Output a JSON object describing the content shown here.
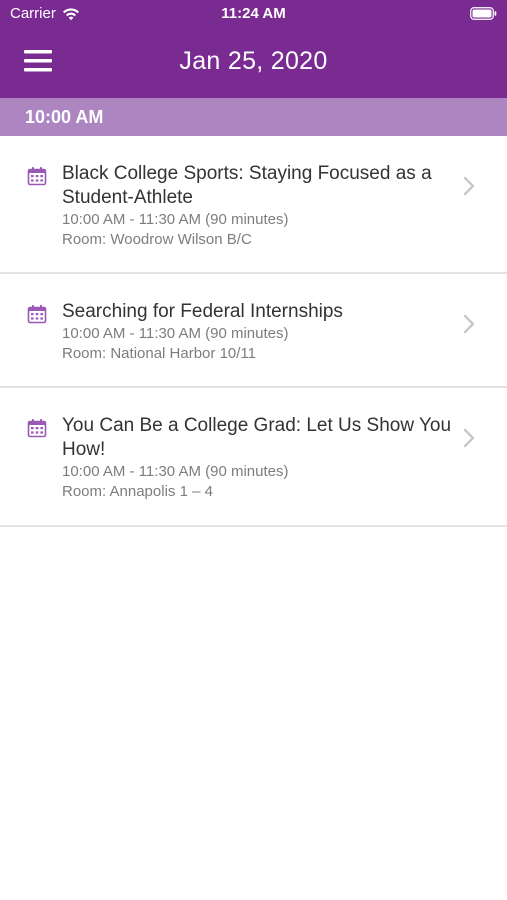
{
  "status_bar": {
    "carrier": "Carrier",
    "time": "11:24 AM",
    "wifi_icon": "wifi-icon",
    "battery_icon": "battery-icon"
  },
  "nav": {
    "title": "Jan 25, 2020",
    "menu_icon": "hamburger-menu-icon"
  },
  "colors": {
    "header_purple": "#7a2b92",
    "section_purple": "#ad86c1",
    "icon_purple": "#9b59b6",
    "chevron_gray": "#c8c8cc",
    "divider_gray": "#e3e3e3"
  },
  "section": {
    "label": "10:00 AM"
  },
  "sessions": [
    {
      "title": "Black College Sports: Staying Focused as a Student-Athlete",
      "time": "10:00 AM - 11:30 AM  (90 minutes)",
      "room": "Room: Woodrow Wilson B/C"
    },
    {
      "title": "Searching for Federal Internships",
      "time": "10:00 AM - 11:30 AM  (90 minutes)",
      "room": "Room: National Harbor 10/11"
    },
    {
      "title": "You Can Be a College Grad: Let Us Show You How!",
      "time": "10:00 AM - 11:30 AM  (90 minutes)",
      "room": "Room: Annapolis 1 – 4"
    }
  ]
}
